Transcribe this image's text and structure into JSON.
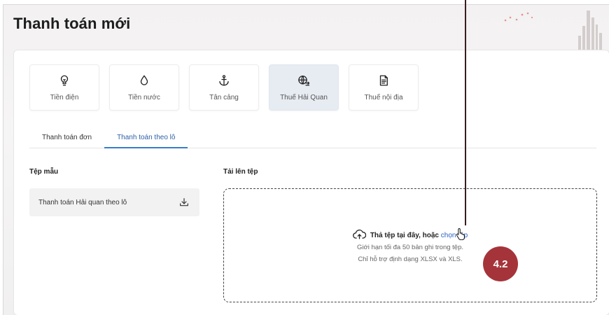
{
  "page": {
    "title": "Thanh toán mới"
  },
  "categories": [
    {
      "label": "Tiền điện",
      "icon": "lightbulb-icon"
    },
    {
      "label": "Tiền nước",
      "icon": "water-drop-icon"
    },
    {
      "label": "Tân cảng",
      "icon": "anchor-icon"
    },
    {
      "label": "Thuế Hải Quan",
      "icon": "globe-exchange-icon"
    },
    {
      "label": "Thuế nội địa",
      "icon": "document-icon"
    }
  ],
  "tabs": [
    {
      "label": "Thanh toán đơn"
    },
    {
      "label": "Thanh toán theo lô"
    }
  ],
  "template": {
    "section_label": "Tệp mẫu",
    "file_name": "Thanh toán Hải quan theo lô",
    "icon": "download-icon"
  },
  "upload": {
    "section_label": "Tải lên tệp",
    "drop_text": "Thả tệp tại đây, hoặc ",
    "link_text": "chọn tệp",
    "icon": "cloud-upload-icon",
    "hint_limit": "Giới hạn tối đa 50 bản ghi trong tệp.",
    "hint_format": "Chỉ hỗ trợ định dạng XLSX và XLS."
  },
  "annotation": {
    "badge": "4.2",
    "color": "#a5343a"
  },
  "colors": {
    "accent": "#2d5fa6",
    "active_category_bg": "#e7ecf3"
  }
}
